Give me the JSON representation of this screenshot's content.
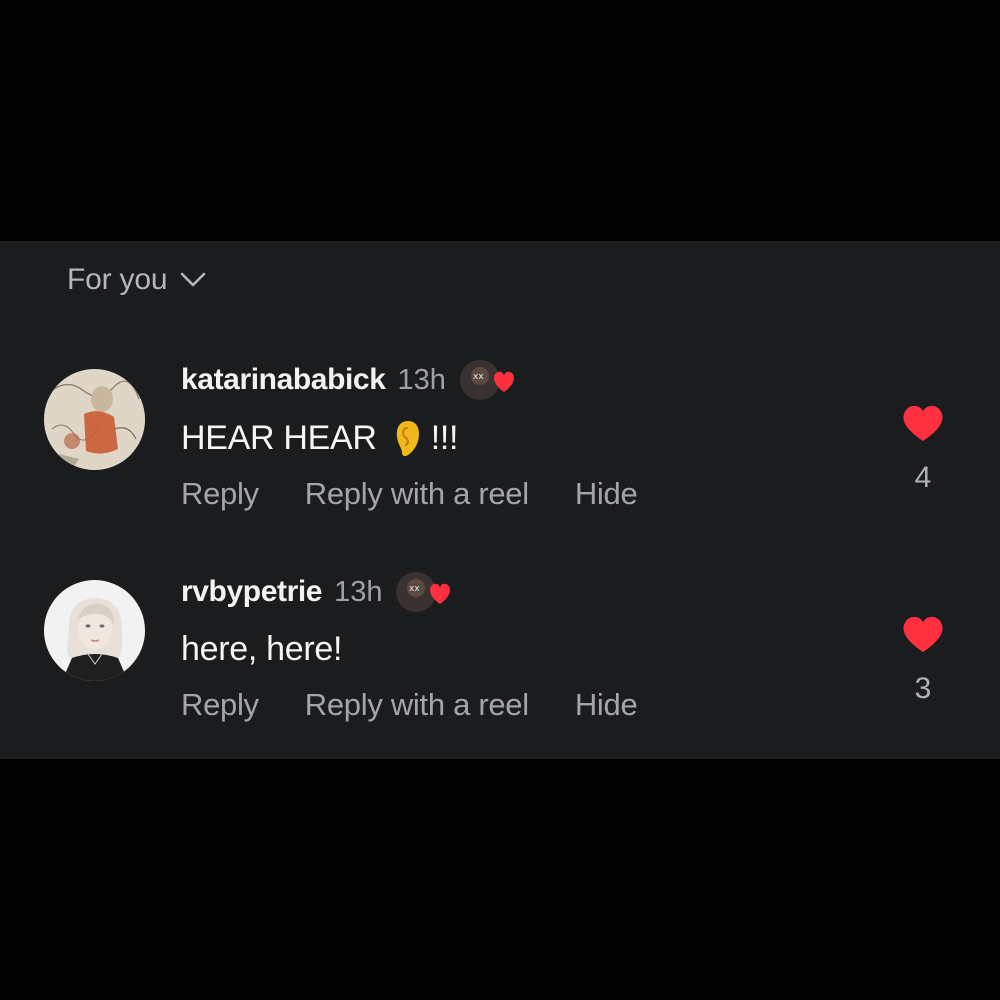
{
  "sort": {
    "label": "For you"
  },
  "comments": [
    {
      "username": "katarinababick",
      "time": "13h",
      "text": "HEAR HEAR",
      "emoji": "ear-icon",
      "text_suffix": "!!!",
      "actions": {
        "reply": "Reply",
        "reply_reel": "Reply with a reel",
        "hide": "Hide"
      },
      "likes": "4",
      "liked_by_creator": true
    },
    {
      "username": "rvbypetrie",
      "time": "13h",
      "text": "here, here!",
      "actions": {
        "reply": "Reply",
        "reply_reel": "Reply with a reel",
        "hide": "Hide"
      },
      "likes": "3",
      "liked_by_creator": true
    }
  ],
  "colors": {
    "background": "#000000",
    "panel": "#1b1c1e",
    "heart": "#ff3040",
    "text_primary": "#f5f5f5",
    "text_secondary": "#a3a5aa"
  }
}
